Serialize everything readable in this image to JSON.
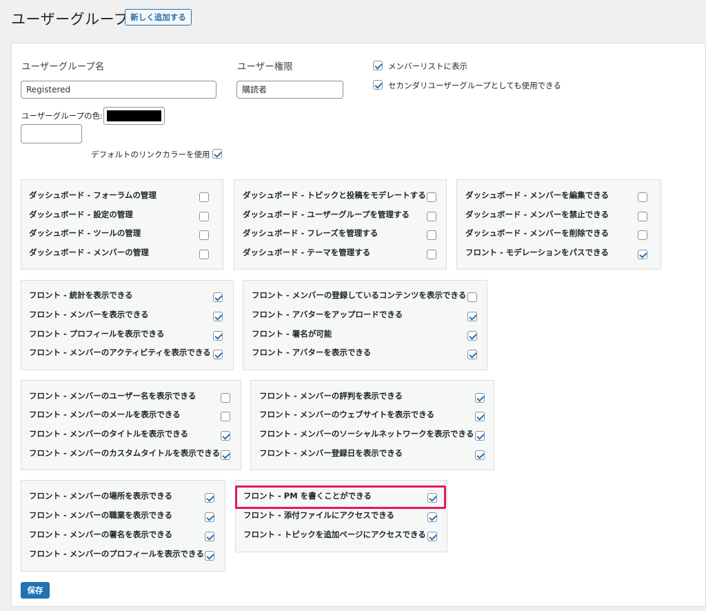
{
  "header": {
    "title": "ユーザーグループ",
    "add_new_label": "新しく追加する"
  },
  "form": {
    "group_name_label": "ユーザーグループ名",
    "group_name_value": "Registered",
    "permission_label": "ユーザー権限",
    "permission_value": "購読者",
    "color_label": "ユーザーグループの色:",
    "color_value": "#000000",
    "default_link_color_label": "デフォルトのリンクカラーを使用",
    "default_link_color_checked": true,
    "show_in_memberlist_label": "メンバーリストに表示",
    "show_in_memberlist_checked": true,
    "secondary_group_label": "セカンダリユーザーグループとしても使用できる",
    "secondary_group_checked": true
  },
  "permissions": {
    "box1": [
      {
        "label": "ダッシュボード - フォーラムの管理",
        "checked": false
      },
      {
        "label": "ダッシュボード - 設定の管理",
        "checked": false
      },
      {
        "label": "ダッシュボード - ツールの管理",
        "checked": false
      },
      {
        "label": "ダッシュボード - メンバーの管理",
        "checked": false
      }
    ],
    "box2": [
      {
        "label": "ダッシュボード - トピックと投稿をモデレートする",
        "checked": false
      },
      {
        "label": "ダッシュボード - ユーザーグループを管理する",
        "checked": false
      },
      {
        "label": "ダッシュボード - フレーズを管理する",
        "checked": false
      },
      {
        "label": "ダッシュボード - テーマを管理する",
        "checked": false
      }
    ],
    "box3": [
      {
        "label": "ダッシュボード - メンバーを編集できる",
        "checked": false
      },
      {
        "label": "ダッシュボード - メンバーを禁止できる",
        "checked": false
      },
      {
        "label": "ダッシュボード - メンバーを削除できる",
        "checked": false
      },
      {
        "label": "フロント - モデレーションをパスできる",
        "checked": true
      }
    ],
    "box4": [
      {
        "label": "フロント - 統計を表示できる",
        "checked": true
      },
      {
        "label": "フロント - メンバーを表示できる",
        "checked": true
      },
      {
        "label": "フロント - プロフィールを表示できる",
        "checked": true
      },
      {
        "label": "フロント - メンバーのアクティビティを表示できる",
        "checked": true
      }
    ],
    "box5": [
      {
        "label": "フロント - メンバーの登録しているコンテンツを表示できる",
        "checked": false
      },
      {
        "label": "フロント - アバターをアップロードできる",
        "checked": true
      },
      {
        "label": "フロント - 署名が可能",
        "checked": true
      },
      {
        "label": "フロント - アバターを表示できる",
        "checked": true
      }
    ],
    "box6": [
      {
        "label": "フロント - メンバーのユーザー名を表示できる",
        "checked": false
      },
      {
        "label": "フロント - メンバーのメールを表示できる",
        "checked": false
      },
      {
        "label": "フロント - メンバーのタイトルを表示できる",
        "checked": true
      },
      {
        "label": "フロント - メンバーのカスタムタイトルを表示できる",
        "checked": true
      }
    ],
    "box7": [
      {
        "label": "フロント - メンバーの評判を表示できる",
        "checked": true
      },
      {
        "label": "フロント - メンバーのウェブサイトを表示できる",
        "checked": true
      },
      {
        "label": "フロント - メンバーのソーシャルネットワークを表示できる",
        "checked": true
      },
      {
        "label": "フロント - メンバー登録日を表示できる",
        "checked": true
      }
    ],
    "box8": [
      {
        "label": "フロント - メンバーの場所を表示できる",
        "checked": true
      },
      {
        "label": "フロント - メンバーの職業を表示できる",
        "checked": true
      },
      {
        "label": "フロント - メンバーの署名を表示できる",
        "checked": true
      },
      {
        "label": "フロント - メンバーのプロフィールを表示できる",
        "checked": true
      }
    ],
    "box9": [
      {
        "label": "フロント - PM を書くことができる",
        "checked": true
      },
      {
        "label": "フロント - 添付ファイルにアクセスできる",
        "checked": true
      },
      {
        "label": "フロント - トピックを追加ページにアクセスできる",
        "checked": true
      }
    ]
  },
  "save_label": "保存",
  "highlight_color": "#e4185a",
  "accent_color": "#2271b1"
}
